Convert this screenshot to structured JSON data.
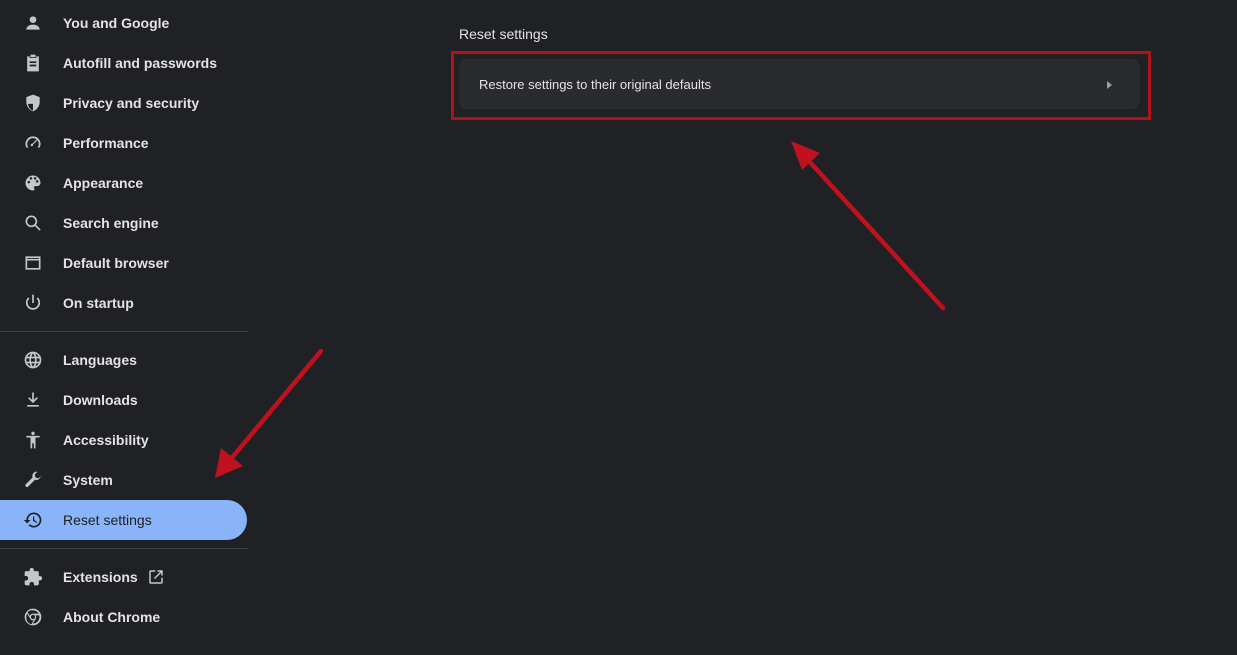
{
  "sidebar": {
    "items": [
      {
        "label": "You and Google",
        "icon": "person-icon"
      },
      {
        "label": "Autofill and passwords",
        "icon": "clipboard-icon"
      },
      {
        "label": "Privacy and security",
        "icon": "shield-icon"
      },
      {
        "label": "Performance",
        "icon": "speedometer-icon"
      },
      {
        "label": "Appearance",
        "icon": "palette-icon"
      },
      {
        "label": "Search engine",
        "icon": "search-icon"
      },
      {
        "label": "Default browser",
        "icon": "browser-window-icon"
      },
      {
        "label": "On startup",
        "icon": "power-icon"
      },
      {
        "label": "Languages",
        "icon": "globe-icon"
      },
      {
        "label": "Downloads",
        "icon": "download-icon"
      },
      {
        "label": "Accessibility",
        "icon": "accessibility-icon"
      },
      {
        "label": "System",
        "icon": "wrench-icon"
      },
      {
        "label": "Reset settings",
        "icon": "history-icon",
        "active": true
      },
      {
        "label": "Extensions",
        "icon": "puzzle-icon"
      },
      {
        "label": "About Chrome",
        "icon": "chrome-icon"
      }
    ]
  },
  "main": {
    "section_title": "Reset settings",
    "restore_label": "Restore settings to their original defaults"
  },
  "colors": {
    "background": "#202124",
    "active_item": "#8ab4f8",
    "card": "#2a2b2e",
    "annotation": "#c0111f"
  }
}
